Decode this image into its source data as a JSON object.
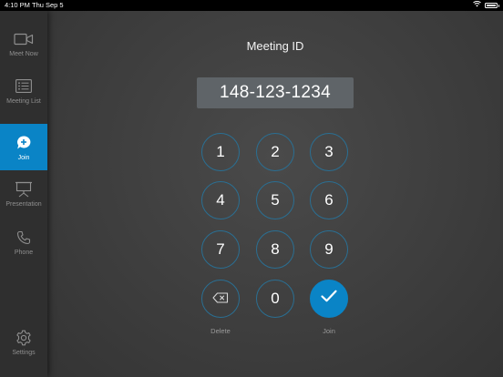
{
  "status_bar": {
    "time": "4:10 PM",
    "date": "Thu Sep 5"
  },
  "sidebar": {
    "items": [
      {
        "label": "Meet Now",
        "icon": "video-camera-icon"
      },
      {
        "label": "Meeting List",
        "icon": "list-icon"
      },
      {
        "label": "Join",
        "icon": "chat-plus-icon",
        "active": true
      },
      {
        "label": "Presentation",
        "icon": "projector-screen-icon"
      },
      {
        "label": "Phone",
        "icon": "phone-icon"
      }
    ],
    "settings_label": "Settings"
  },
  "main": {
    "title": "Meeting ID",
    "meeting_id": "148-123-1234",
    "keys": [
      "1",
      "2",
      "3",
      "4",
      "5",
      "6",
      "7",
      "8",
      "9",
      "0"
    ],
    "delete_label": "Delete",
    "join_label": "Join"
  },
  "colors": {
    "accent": "#0a84c6",
    "sidebar_bg": "#2f2f2f",
    "main_bg": "#404040",
    "display_bg": "#5f6468",
    "key_border": "#2a6f93"
  }
}
